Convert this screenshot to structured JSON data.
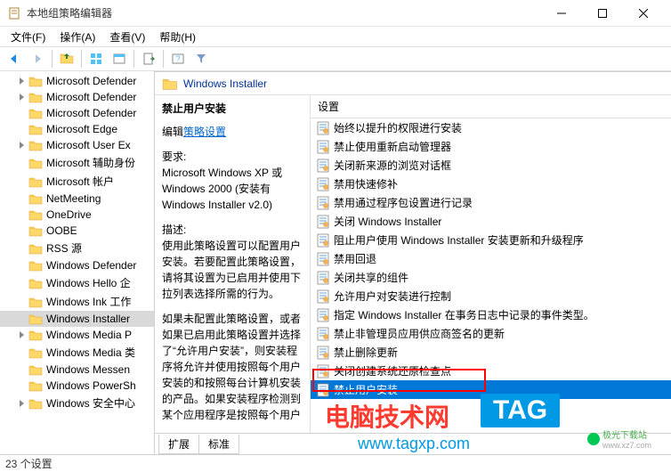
{
  "window": {
    "title": "本地组策略编辑器"
  },
  "menu": {
    "file": "文件(F)",
    "action": "操作(A)",
    "view": "查看(V)",
    "help": "帮助(H)"
  },
  "tree": {
    "items": [
      {
        "label": "Microsoft Defender",
        "expandable": true,
        "selected": false
      },
      {
        "label": "Microsoft Defender",
        "expandable": true,
        "selected": false
      },
      {
        "label": "Microsoft Defender",
        "expandable": false,
        "selected": false
      },
      {
        "label": "Microsoft Edge",
        "expandable": false,
        "selected": false
      },
      {
        "label": "Microsoft User Ex",
        "expandable": true,
        "selected": false
      },
      {
        "label": "Microsoft 辅助身份",
        "expandable": false,
        "selected": false
      },
      {
        "label": "Microsoft 帐户",
        "expandable": false,
        "selected": false
      },
      {
        "label": "NetMeeting",
        "expandable": false,
        "selected": false
      },
      {
        "label": "OneDrive",
        "expandable": false,
        "selected": false
      },
      {
        "label": "OOBE",
        "expandable": false,
        "selected": false
      },
      {
        "label": "RSS 源",
        "expandable": false,
        "selected": false
      },
      {
        "label": "Windows Defender",
        "expandable": false,
        "selected": false
      },
      {
        "label": "Windows Hello 企",
        "expandable": false,
        "selected": false
      },
      {
        "label": "Windows Ink 工作",
        "expandable": false,
        "selected": false
      },
      {
        "label": "Windows Installer",
        "expandable": false,
        "selected": true
      },
      {
        "label": "Windows Media P",
        "expandable": true,
        "selected": false
      },
      {
        "label": "Windows Media 类",
        "expandable": false,
        "selected": false
      },
      {
        "label": "Windows Messen",
        "expandable": false,
        "selected": false
      },
      {
        "label": "Windows PowerSh",
        "expandable": false,
        "selected": false
      },
      {
        "label": "Windows 安全中心",
        "expandable": true,
        "selected": false
      }
    ]
  },
  "header": {
    "title": "Windows Installer"
  },
  "detail": {
    "title": "禁止用户安装",
    "edit_prefix": "编辑",
    "edit_link": "策略设置",
    "req_label": "要求:",
    "req_text": "Microsoft Windows XP 或 Windows 2000 (安装有 Windows Installer v2.0)",
    "desc_label": "描述:",
    "desc1": "使用此策略设置可以配置用户安装。若要配置此策略设置，请将其设置为已启用并使用下拉列表选择所需的行为。",
    "desc2": "如果未配置此策略设置，或者如果已启用此策略设置并选择了“允许用户安装”，则安装程序将允许并使用按照每个用户安装的和按照每台计算机安装的产品。如果安装程序检测到某个应用程序是按照每个用户"
  },
  "list": {
    "header": "设置",
    "items": [
      {
        "label": "始终以提升的权限进行安装",
        "state": "normal"
      },
      {
        "label": "禁止使用重新启动管理器",
        "state": "normal"
      },
      {
        "label": "关闭新来源的浏览对话框",
        "state": "normal"
      },
      {
        "label": "禁用快速修补",
        "state": "normal"
      },
      {
        "label": "禁用通过程序包设置进行记录",
        "state": "normal"
      },
      {
        "label": "关闭 Windows Installer",
        "state": "normal"
      },
      {
        "label": "阻止用户使用 Windows Installer 安装更新和升级程序",
        "state": "normal"
      },
      {
        "label": "禁用回退",
        "state": "normal"
      },
      {
        "label": "关闭共享的组件",
        "state": "normal"
      },
      {
        "label": "允许用户对安装进行控制",
        "state": "normal"
      },
      {
        "label": "指定 Windows Installer 在事务日志中记录的事件类型。",
        "state": "normal"
      },
      {
        "label": "禁止非管理员应用供应商签名的更新",
        "state": "normal"
      },
      {
        "label": "禁止删除更新",
        "state": "normal"
      },
      {
        "label": "关闭创建系统还原检查点",
        "state": "normal"
      },
      {
        "label": "禁止用户安装",
        "state": "highlighted"
      }
    ]
  },
  "tabs": {
    "extended": "扩展",
    "standard": "标准"
  },
  "statusbar": {
    "text": "23 个设置"
  },
  "watermark": {
    "text1": "电脑技术网",
    "tag": "TAG",
    "url": "www.tagxp.com",
    "jg1": "极光下载站",
    "jg2": "www.xz7.com"
  }
}
